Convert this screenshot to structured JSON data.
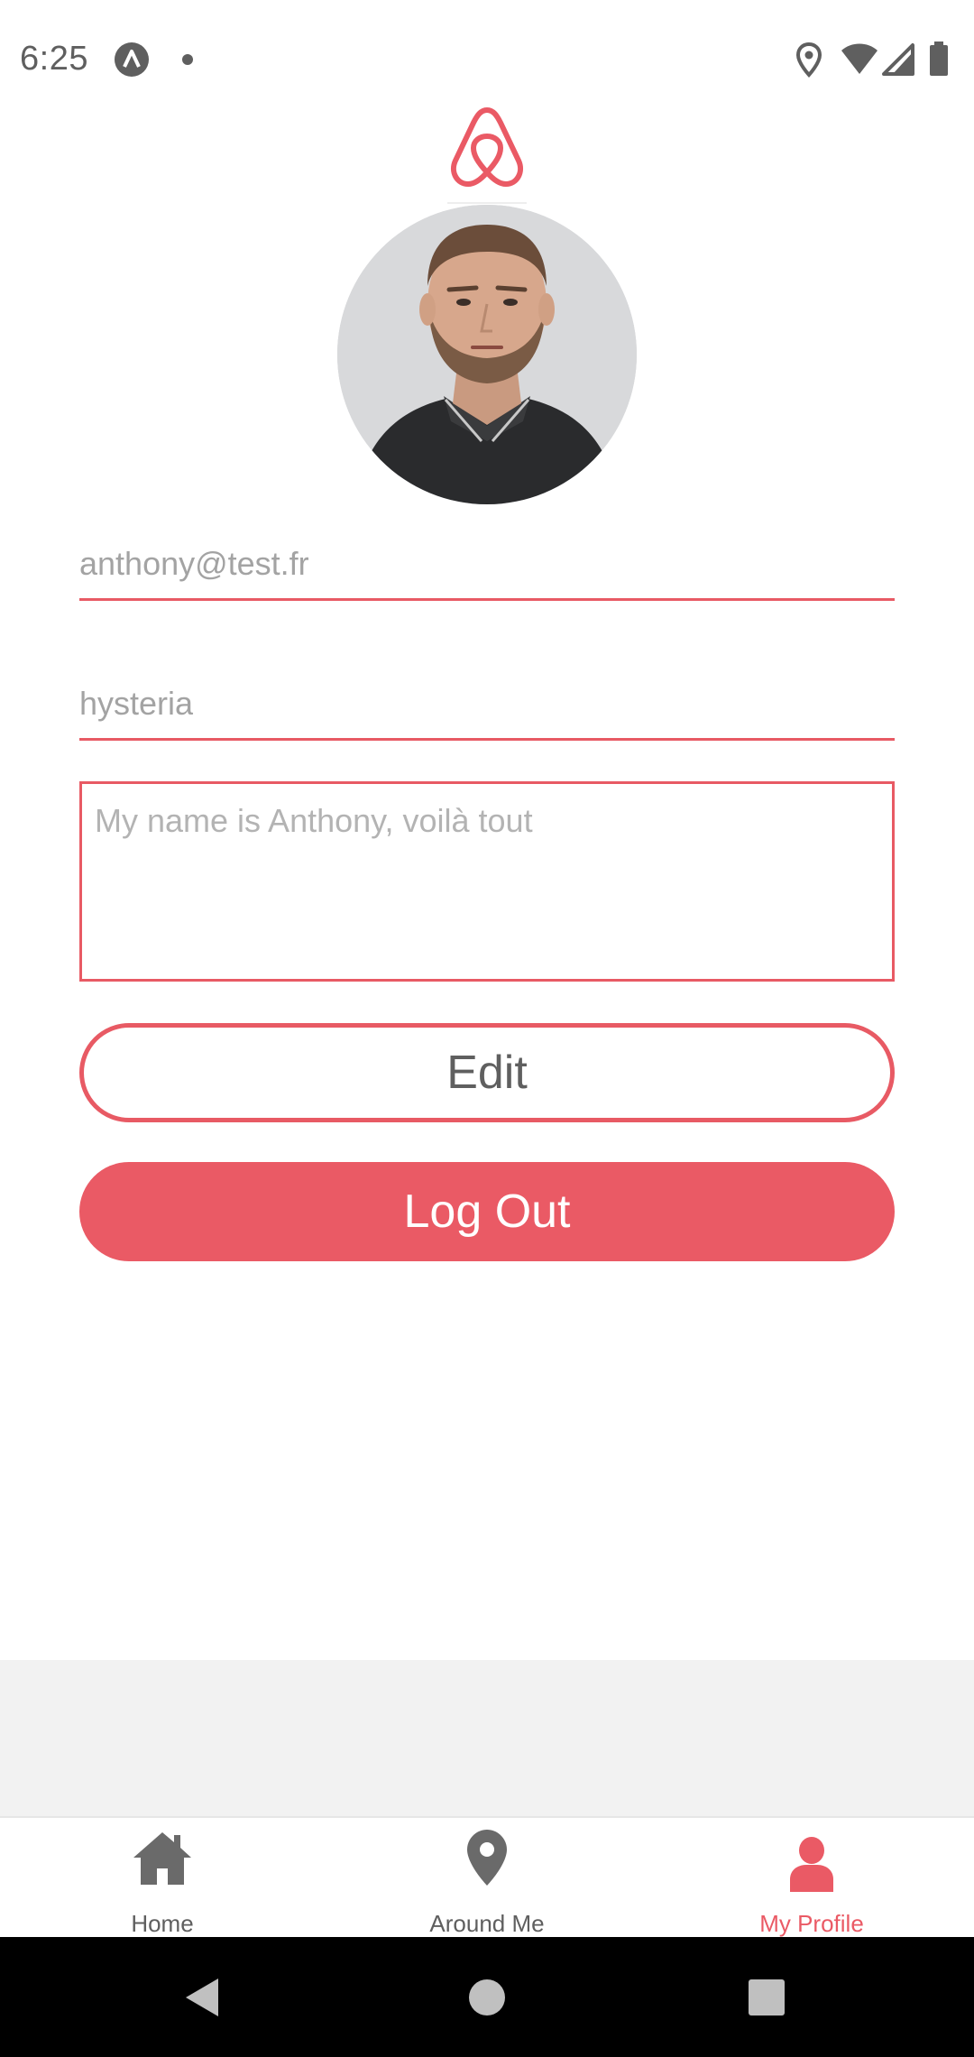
{
  "status_bar": {
    "time": "6:25",
    "icons": [
      "app-notification-icon",
      "notification-dot-icon",
      "location-icon",
      "wifi-icon",
      "signal-icon",
      "battery-icon"
    ]
  },
  "logo": {
    "icon": "airbnb-logo-icon"
  },
  "profile": {
    "avatar": "profile-photo",
    "email": "anthony@test.fr",
    "username": "hysteria",
    "description": "My name is Anthony, voilà tout"
  },
  "actions": {
    "edit_label": "Edit",
    "logout_label": "Log Out"
  },
  "tabs": [
    {
      "label": "Home",
      "icon": "home-icon",
      "active": false
    },
    {
      "label": "Around Me",
      "icon": "map-pin-icon",
      "active": false
    },
    {
      "label": "My Profile",
      "icon": "person-icon",
      "active": true
    }
  ],
  "system_nav": [
    "back-icon",
    "home-circle-icon",
    "recents-icon"
  ],
  "colors": {
    "accent": "#ea5a65",
    "text_gray": "#5f5f5f",
    "placeholder_gray": "#a3a3a3",
    "gray_area": "#f2f2f2"
  }
}
